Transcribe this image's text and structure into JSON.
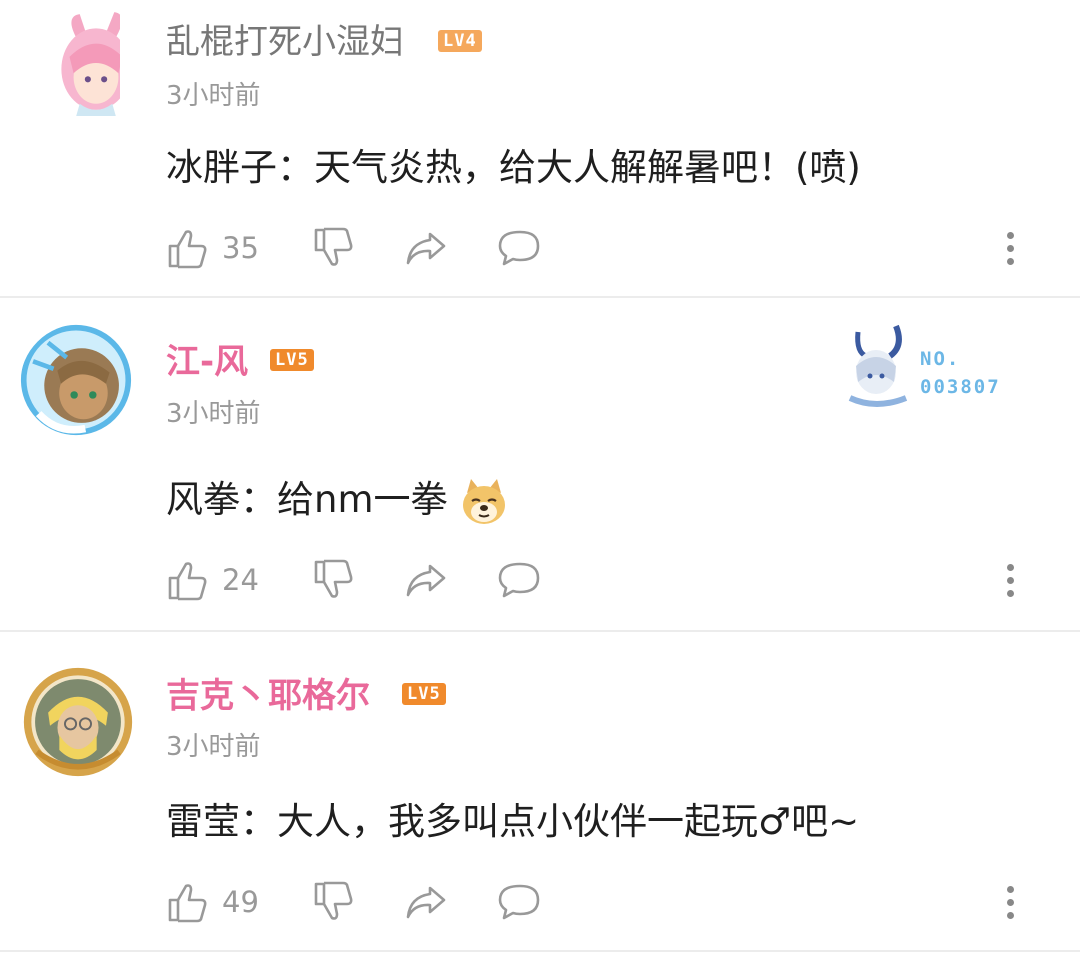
{
  "comments": [
    {
      "username": "乱棍打死小湿妇",
      "level": "LV4",
      "time": "3小时前",
      "text": "冰胖子：天气炎热，给大人解解暑吧！(喷)",
      "likes": "35"
    },
    {
      "username": "江-风",
      "level": "LV5",
      "time": "3小时前",
      "text_prefix": "风拳：给nm一拳",
      "emoji": "doge-icon",
      "likes": "24",
      "badge": {
        "no_label": "NO.",
        "number": "003807"
      }
    },
    {
      "username": "吉克丶耶格尔",
      "level": "LV5",
      "time": "3小时前",
      "text": "雷莹：大人，我多叫点小伙伴一起玩♂吧~",
      "likes": "49"
    }
  ],
  "icons": [
    "like-icon",
    "dislike-icon",
    "share-icon",
    "reply-icon",
    "more-icon"
  ],
  "colors": {
    "lv4": "#f5a85c",
    "lv5": "#f08a2c",
    "vip_name": "#e9699a"
  }
}
